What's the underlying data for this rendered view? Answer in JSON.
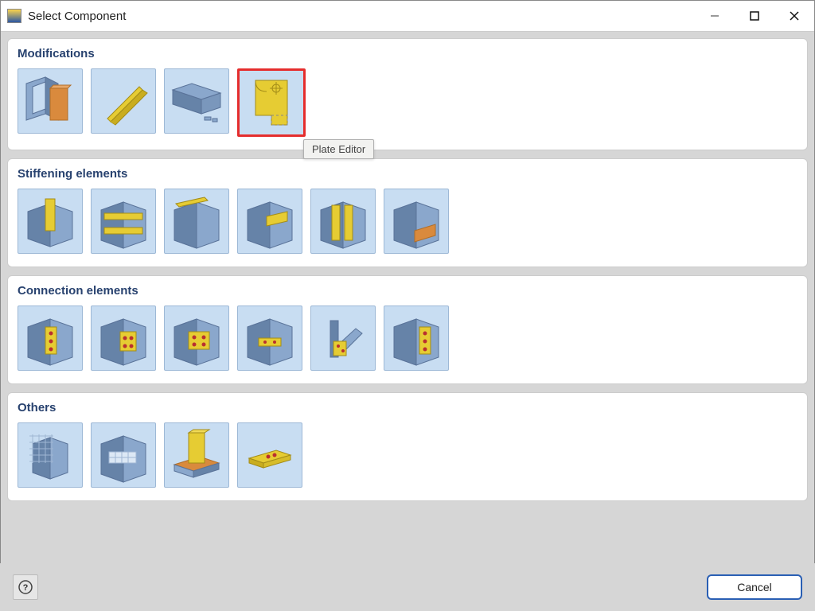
{
  "window": {
    "title": "Select Component"
  },
  "sections": {
    "modifications": {
      "title": "Modifications"
    },
    "stiffening": {
      "title": "Stiffening elements"
    },
    "connection": {
      "title": "Connection elements"
    },
    "others": {
      "title": "Others"
    }
  },
  "tooltip": "Plate Editor",
  "footer": {
    "cancel": "Cancel"
  },
  "thumbs": {
    "modifications": [
      "beam-cut",
      "plate-tilt",
      "beam-split",
      "plate-editor"
    ],
    "stiffening": [
      "stiff-1",
      "stiff-2",
      "stiff-3",
      "stiff-4",
      "stiff-5",
      "stiff-6"
    ],
    "connection": [
      "conn-1",
      "conn-2",
      "conn-3",
      "conn-4",
      "conn-5",
      "conn-6"
    ],
    "others": [
      "other-1",
      "other-2",
      "other-3",
      "other-4"
    ]
  },
  "selected_thumb": "plate-editor",
  "colors": {
    "tile_bg": "#c8ddf2",
    "steel_dark": "#6683a8",
    "steel_mid": "#8aa7cc",
    "steel_light": "#b9cfe8",
    "plate_yellow": "#e6cc33",
    "plate_yellow_dark": "#c9ad1f",
    "bolt_red": "#b9302f",
    "plate_orange": "#d98a3d",
    "selection_red": "#e52d2d",
    "heading": "#28426f"
  }
}
